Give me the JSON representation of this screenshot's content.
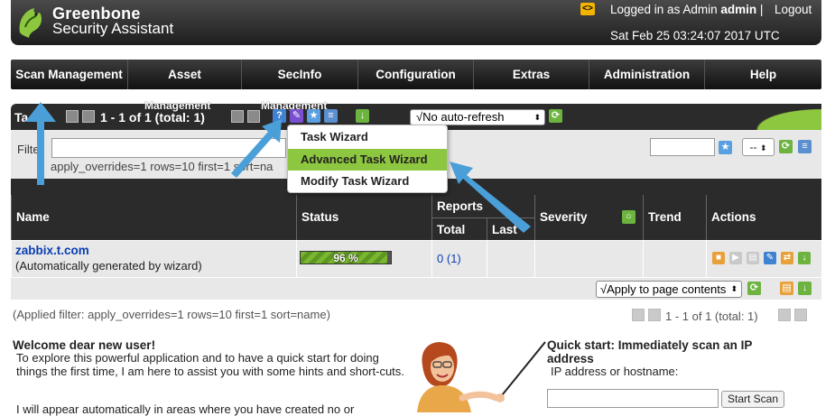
{
  "header": {
    "brand_line1": "Greenbone",
    "brand_line2": "Security Assistant",
    "language_icon": "<>",
    "logged_in_prefix": "Logged in as Admin",
    "logged_in_user": "admin",
    "logout_label": "Logout",
    "datetime": "Sat Feb 25 03:24:07 2017 UTC"
  },
  "menu": {
    "items": [
      {
        "label": "Scan Management"
      },
      {
        "label": "Asset"
      },
      {
        "label": "SecInfo"
      },
      {
        "label": "Configuration"
      },
      {
        "label": "Extras"
      },
      {
        "label": "Administration"
      },
      {
        "label": "Help"
      }
    ]
  },
  "section": {
    "title_partial": "Ta",
    "pagination": "1 - 1 of 1 (total: 1)",
    "overlay_label_1": "Management",
    "overlay_label_2": "Management",
    "refresh_select_value": "√No auto-refresh"
  },
  "filter": {
    "label": "Filte",
    "applied_text": "apply_overrides=1 rows=10 first=1 sort=na",
    "filter_select_value": "--"
  },
  "dropdown": {
    "items": [
      {
        "label": "Task Wizard"
      },
      {
        "label": "Advanced Task Wizard"
      },
      {
        "label": "Modify Task Wizard"
      }
    ]
  },
  "table": {
    "headers": {
      "name": "Name",
      "status": "Status",
      "reports": "Reports",
      "reports_total": "Total",
      "reports_last": "Last",
      "severity": "Severity",
      "trend": "Trend",
      "actions": "Actions"
    },
    "rows": [
      {
        "name": "zabbix.t.com",
        "comment": "(Automatically generated by wizard)",
        "status_text": "96 %",
        "progress": 0.96,
        "reports_total": "0",
        "reports_total_paren": "(1)"
      }
    ],
    "apply_select_value": "√Apply to page contents",
    "applied_filter": "(Applied filter: apply_overrides=1 rows=10 first=1 sort=name)",
    "pager": "1 - 1 of 1 (total: 1)"
  },
  "welcome": {
    "title": "Welcome dear new user!",
    "text": "To explore this powerful application and to have a quick start for doing things the first time, I am here to assist you with some hints and short-cuts.",
    "text2": "I will appear automatically in areas where you have created no or"
  },
  "quick_start": {
    "title": "Quick start: Immediately scan an IP address",
    "label": "IP address or hostname:",
    "input_value": "",
    "button_label": "Start Scan"
  },
  "colors": {
    "accent_green": "#8dc63f",
    "dark_bar": "#2b2b2b",
    "link_blue": "#0b3eb3",
    "arrow_blue": "#4a9fd8"
  }
}
